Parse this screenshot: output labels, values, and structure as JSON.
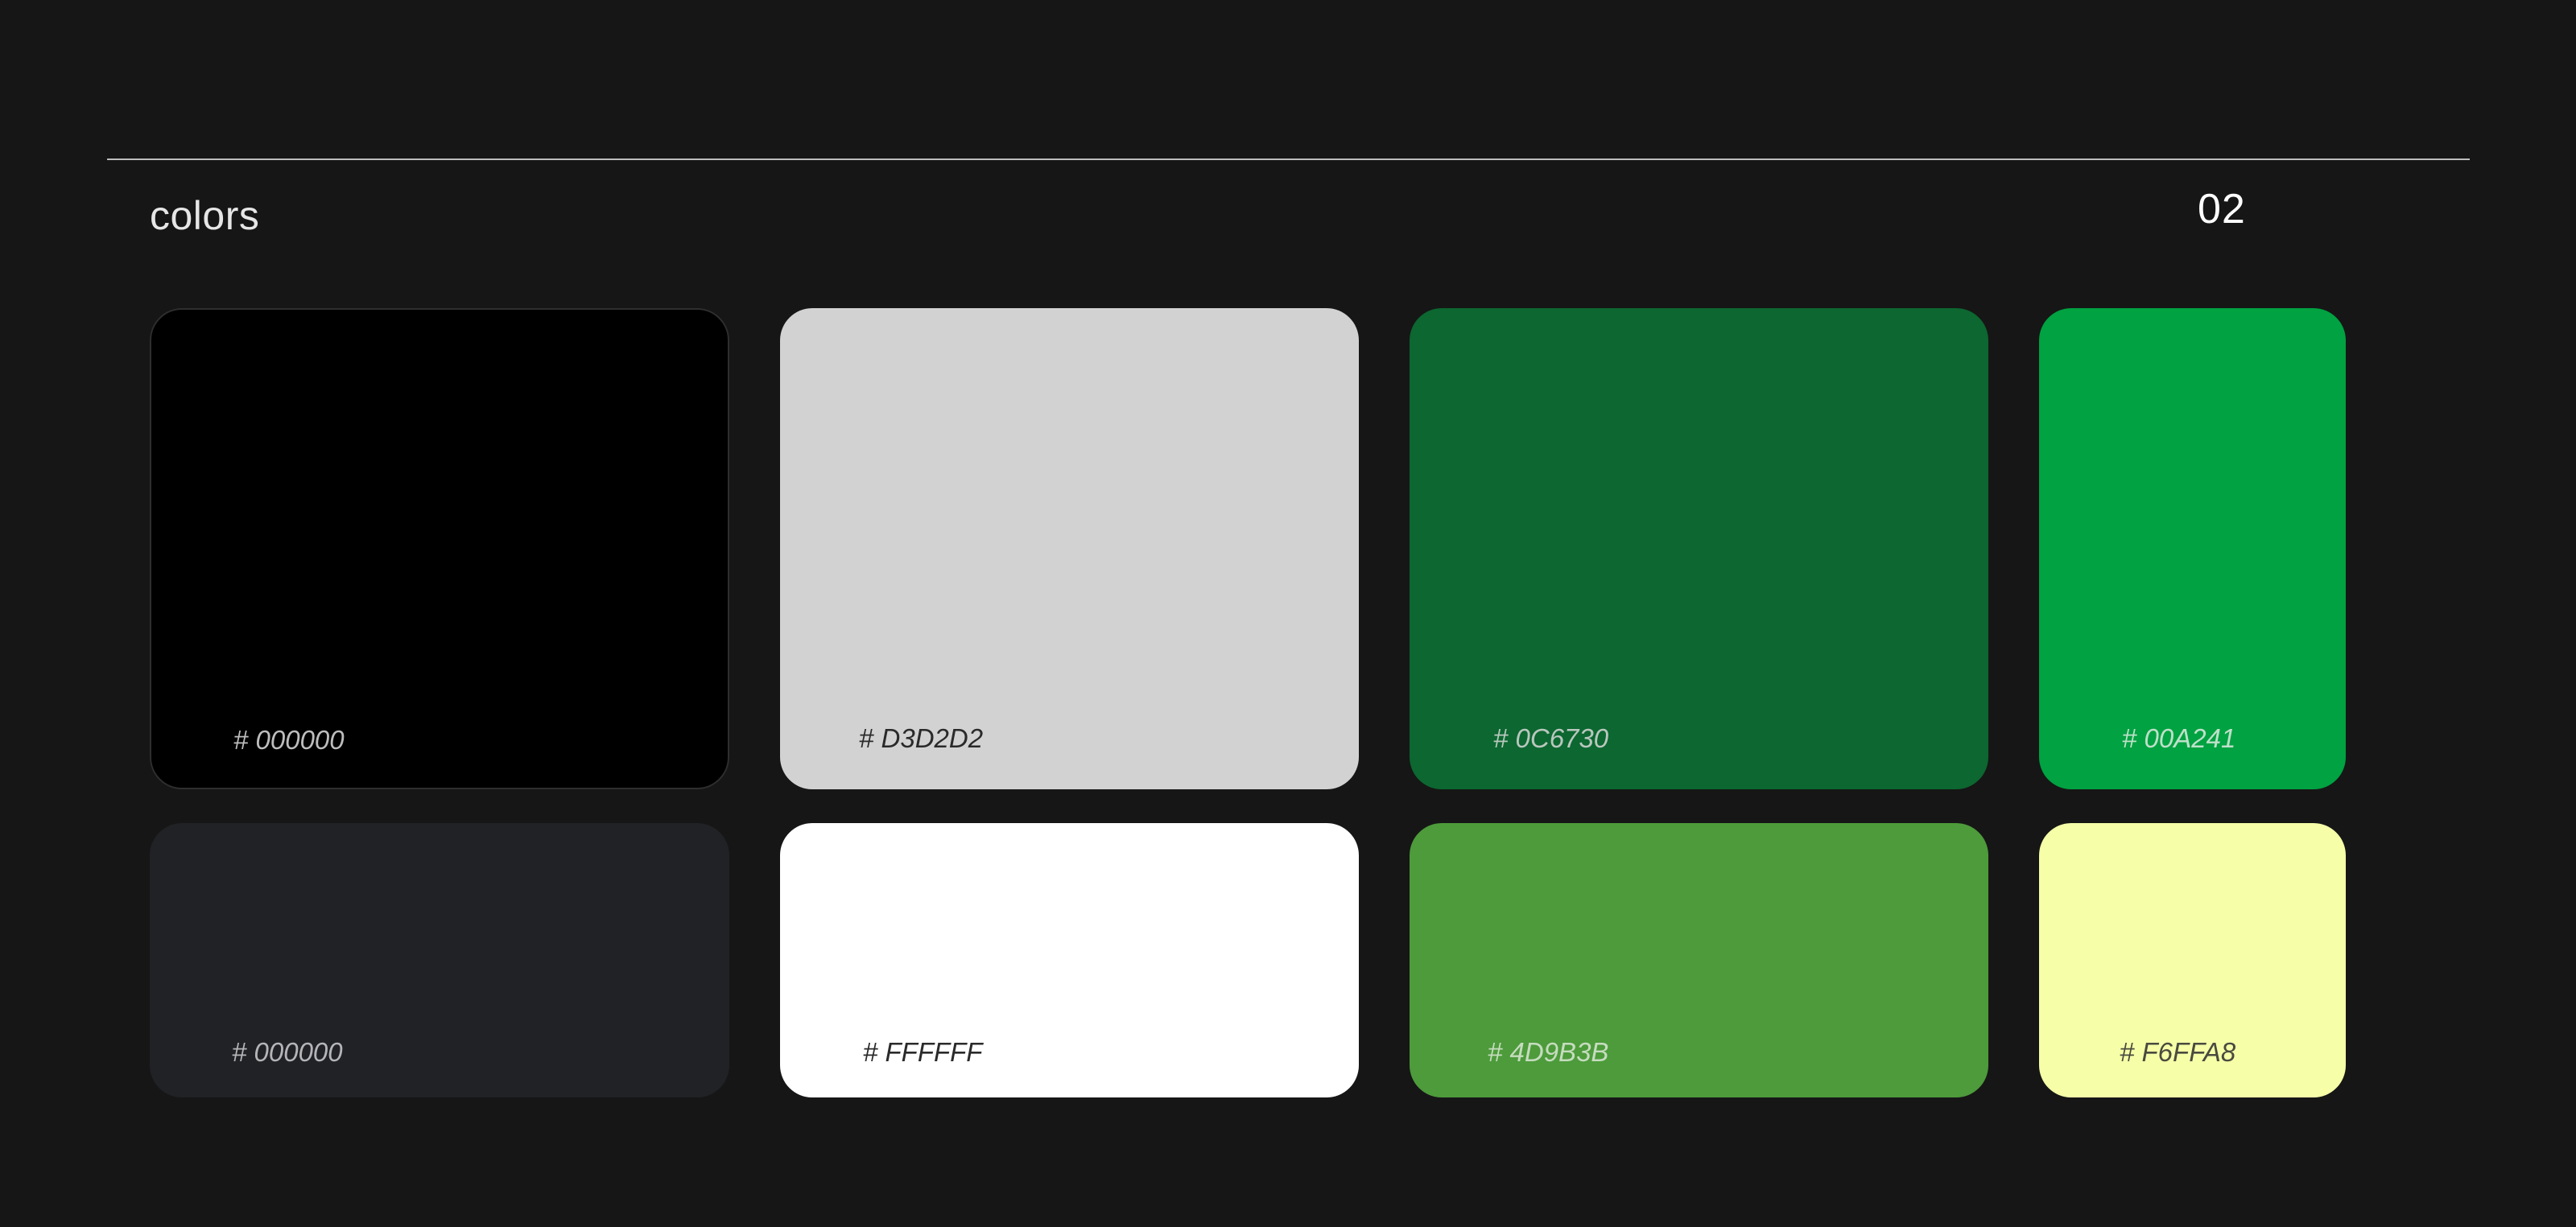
{
  "header": {
    "title": "colors",
    "page_number": "02"
  },
  "swatches": [
    {
      "code": "# 000000",
      "color": "#000000",
      "label_color": "#bdbdbd"
    },
    {
      "code": "# D3D2D2",
      "color": "#D3D2D2",
      "label_color": "#2a2a2a"
    },
    {
      "code": "# 0C6730",
      "color": "#0C6730",
      "label_color": "#b9c7be"
    },
    {
      "code": "# 00A241",
      "color": "#00A241",
      "label_color": "#bfe0c9"
    },
    {
      "code": "# 000000",
      "color": "#212226",
      "label_color": "#b5b5b8"
    },
    {
      "code": "# FFFFFF",
      "color": "#FFFFFF",
      "label_color": "#2a2a2a"
    },
    {
      "code": "# 4D9B3B",
      "color": "#4D9B3B",
      "label_color": "#c6dcbf"
    },
    {
      "code": "# F6FFA8",
      "color": "#F6FFA8",
      "label_color": "#4a4a40"
    }
  ]
}
